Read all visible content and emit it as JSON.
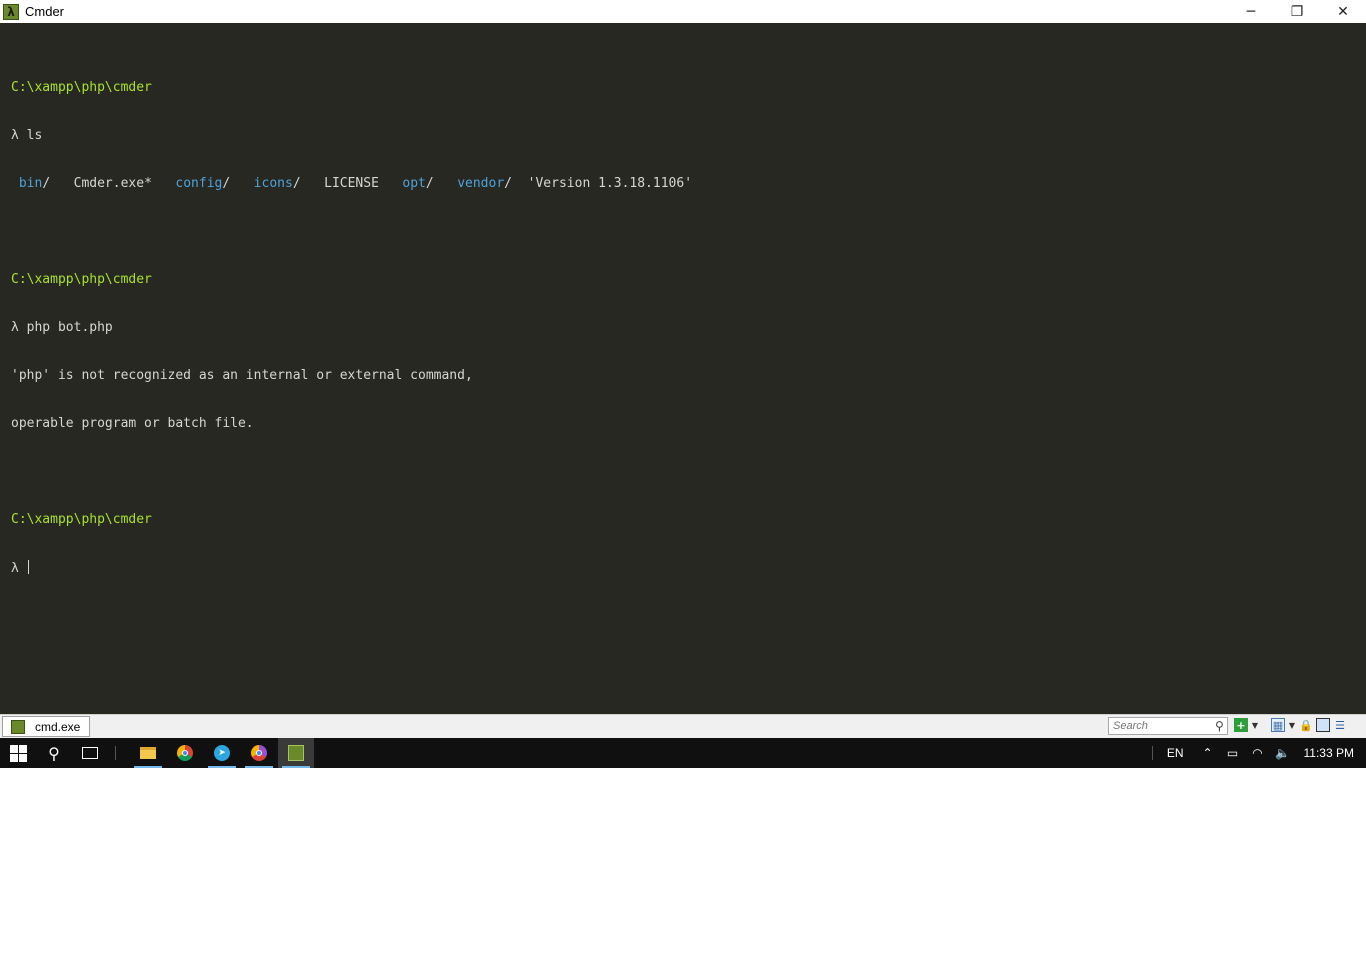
{
  "window": {
    "title": "Cmder",
    "app_icon_glyph": "λ",
    "controls": {
      "minimize": "─",
      "maximize": "❐",
      "close": "✕"
    }
  },
  "terminal": {
    "path": "C:\\xampp\\php\\cmder",
    "prompt_symbol": "λ",
    "cmd1": "ls",
    "ls_entries": [
      {
        "name": "bin",
        "suffix": "/",
        "kind": "dir"
      },
      {
        "name": "Cmder.exe",
        "suffix": "*",
        "kind": "exe"
      },
      {
        "name": "config",
        "suffix": "/",
        "kind": "dir"
      },
      {
        "name": "icons",
        "suffix": "/",
        "kind": "dir"
      },
      {
        "name": "LICENSE",
        "suffix": "",
        "kind": "file"
      },
      {
        "name": "opt",
        "suffix": "/",
        "kind": "dir"
      },
      {
        "name": "vendor",
        "suffix": "/",
        "kind": "dir"
      },
      {
        "name": "'Version 1.3.18.1106'",
        "suffix": "",
        "kind": "file"
      }
    ],
    "cmd2": "php bot.php",
    "error_line1": "'php' is not recognized as an internal or external command,",
    "error_line2": "operable program or batch file."
  },
  "statusbar": {
    "console_tab_label": "cmd.exe",
    "search_placeholder": "Search"
  },
  "taskbar": {
    "pinned_apps": [
      "file-explorer",
      "chrome",
      "telegram",
      "chrome-profile",
      "cmder"
    ],
    "language": "EN",
    "time": "11:33 PM"
  }
}
